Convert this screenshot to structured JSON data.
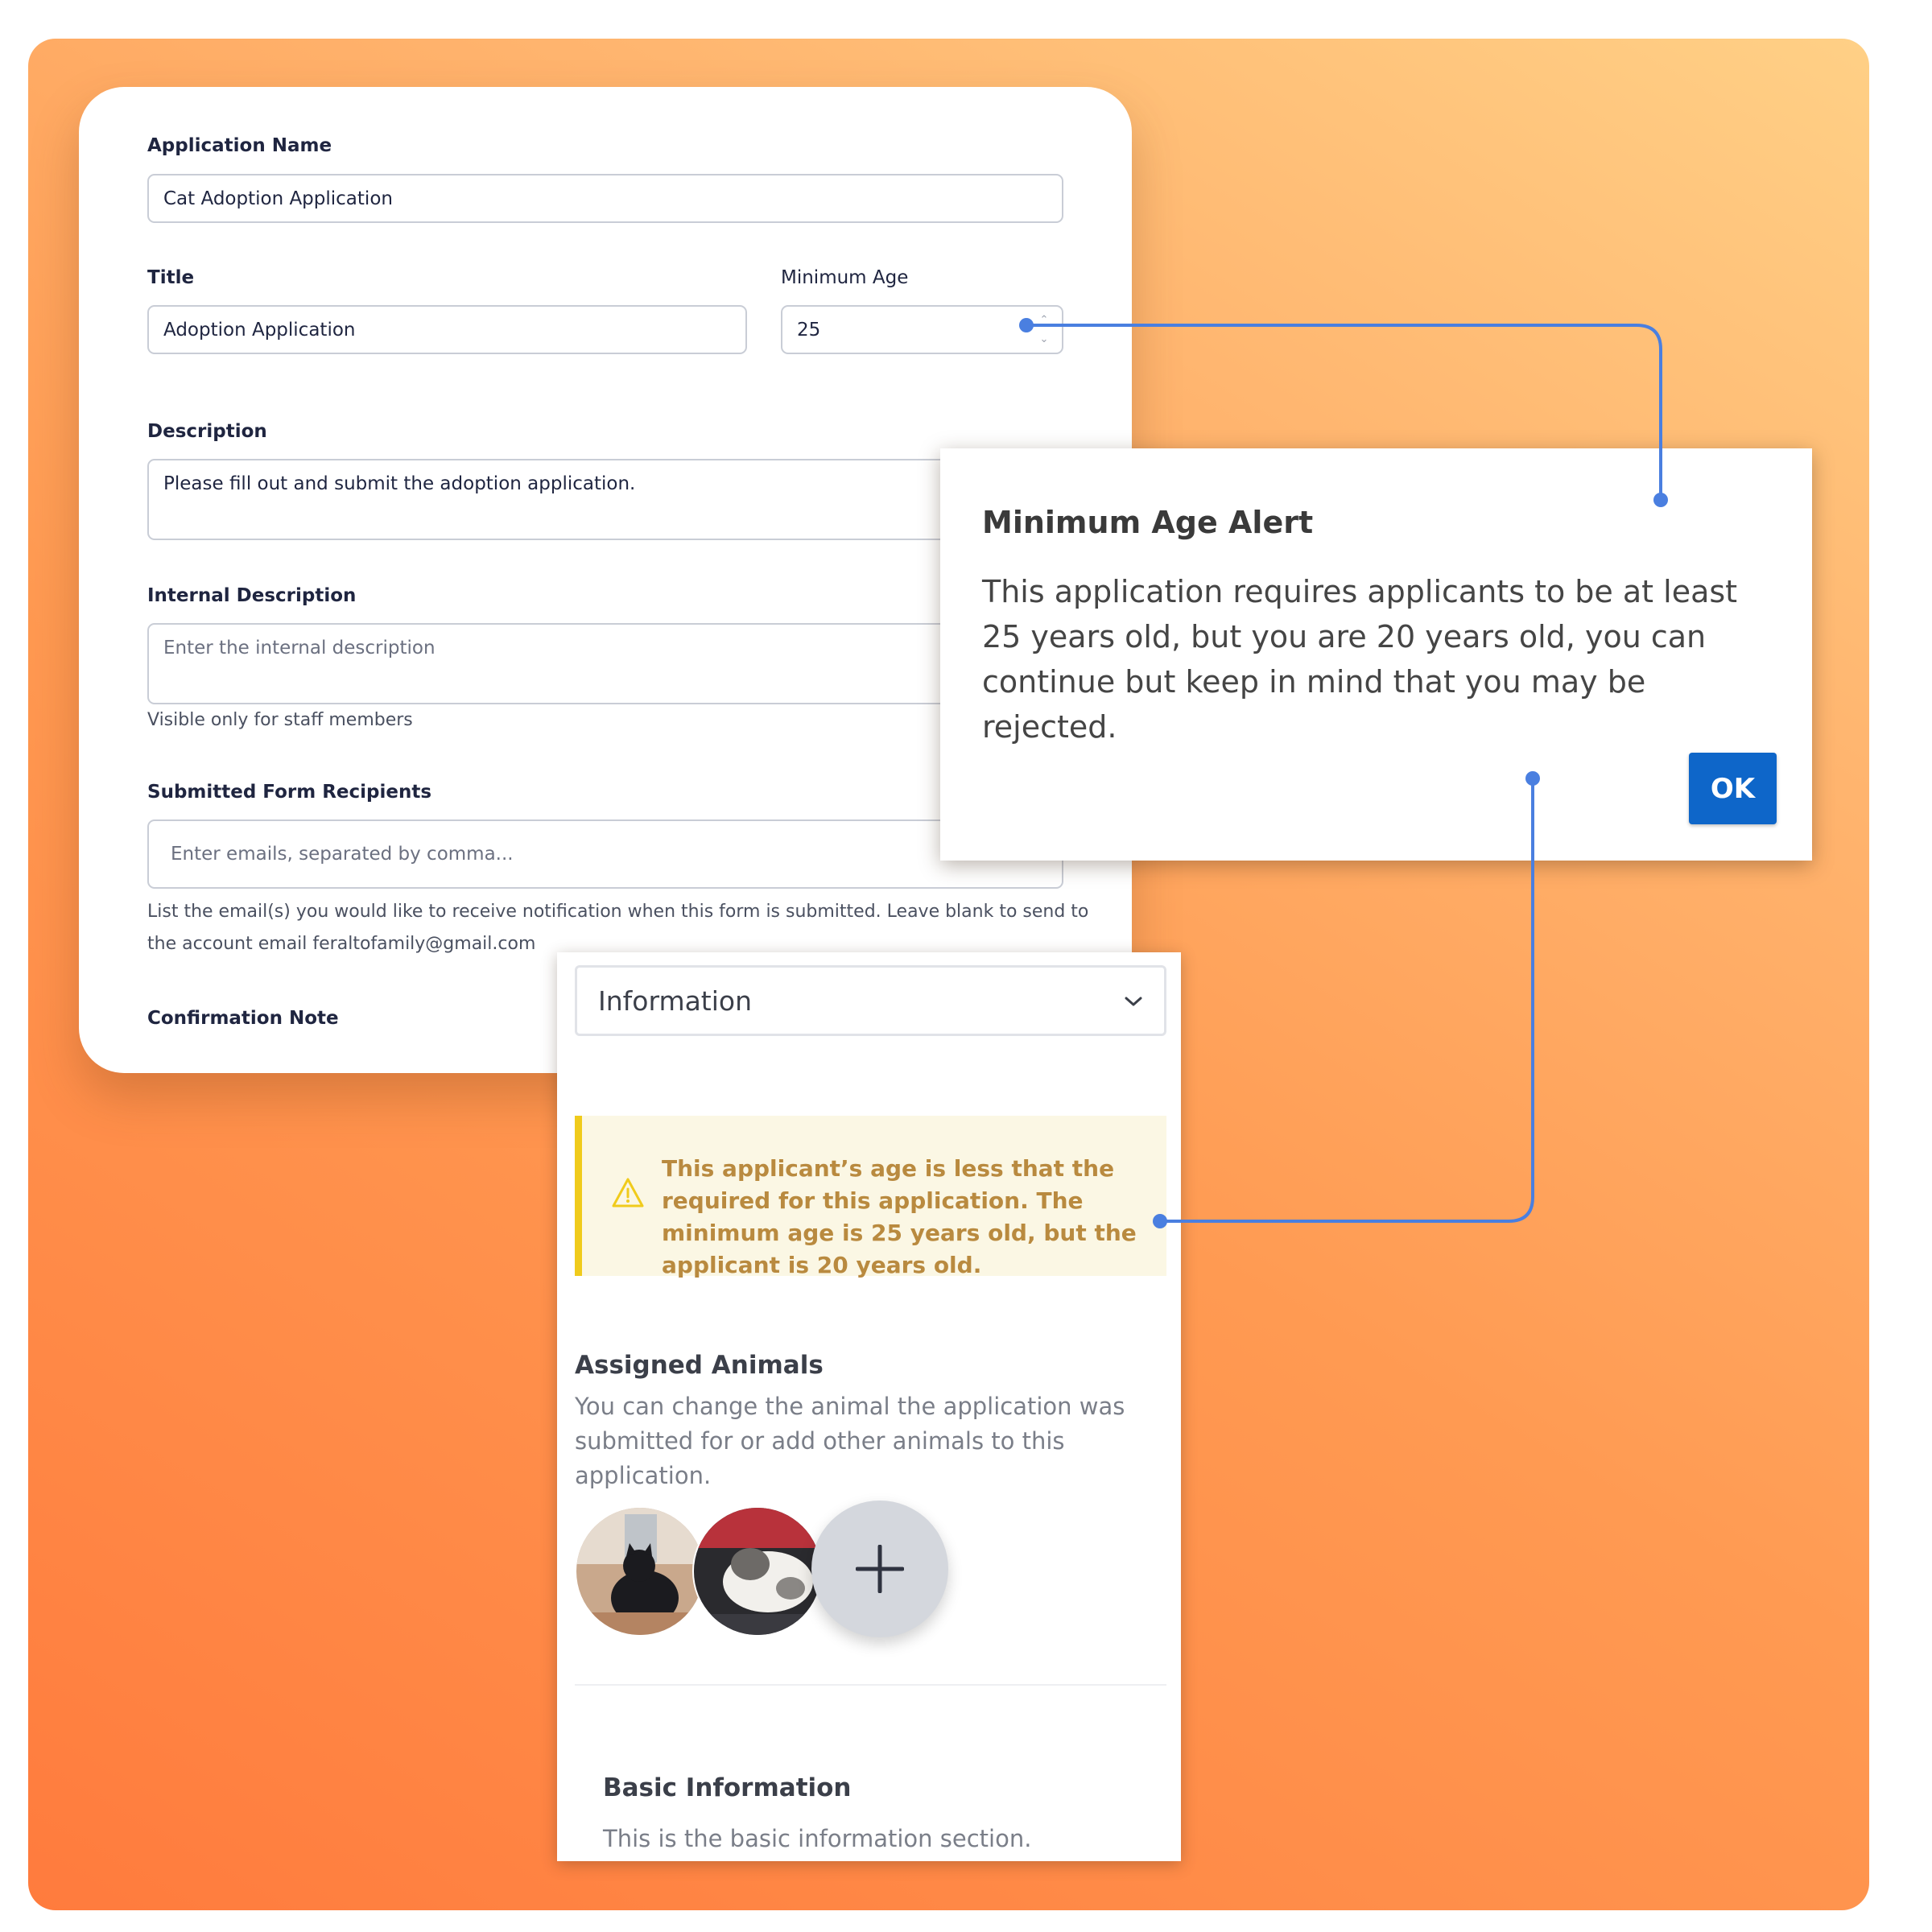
{
  "form": {
    "application_name_label": "Application Name",
    "application_name_value": "Cat Adoption Application",
    "title_label": "Title",
    "title_value": "Adoption Application",
    "min_age_label": "Minimum Age",
    "min_age_value": "25",
    "description_label": "Description",
    "description_value": "Please fill out and submit the adoption application.",
    "internal_description_label": "Internal Description",
    "internal_description_placeholder": "Enter the internal description",
    "internal_description_help": "Visible only for staff members",
    "recipients_label": "Submitted Form Recipients",
    "recipients_placeholder": "Enter emails, separated by comma...",
    "recipients_help_line1": "List the email(s) you would like to receive notification when this form is submitted. Leave blank to send to",
    "recipients_help_line2": "the account email feraltofamily@gmail.com",
    "confirmation_note_label": "Confirmation Note"
  },
  "alert": {
    "title": "Minimum Age Alert",
    "message": "This application requires applicants to be at least 25 years old, but you are 20 years old, you can continue but keep in mind that you may be rejected.",
    "ok_label": "OK",
    "ok_color": "#0e66c9"
  },
  "panel": {
    "select_value": "Information",
    "warning_text": "This applicant’s age is less that the required for this application. The minimum age is 25 years old, but the applicant is 20 years old.",
    "assigned_title": "Assigned Animals",
    "assigned_desc": "You can change the animal the application was submitted for or add other animals to this application.",
    "animals": [
      "black-cat-photo",
      "white-cat-photo"
    ],
    "add_icon": "plus-icon",
    "basic_title": "Basic Information",
    "basic_desc": "This is the basic information section."
  },
  "colors": {
    "connector": "#4a7fe0",
    "warning_border": "#f0cb1c",
    "warning_text": "#b98a3f"
  }
}
